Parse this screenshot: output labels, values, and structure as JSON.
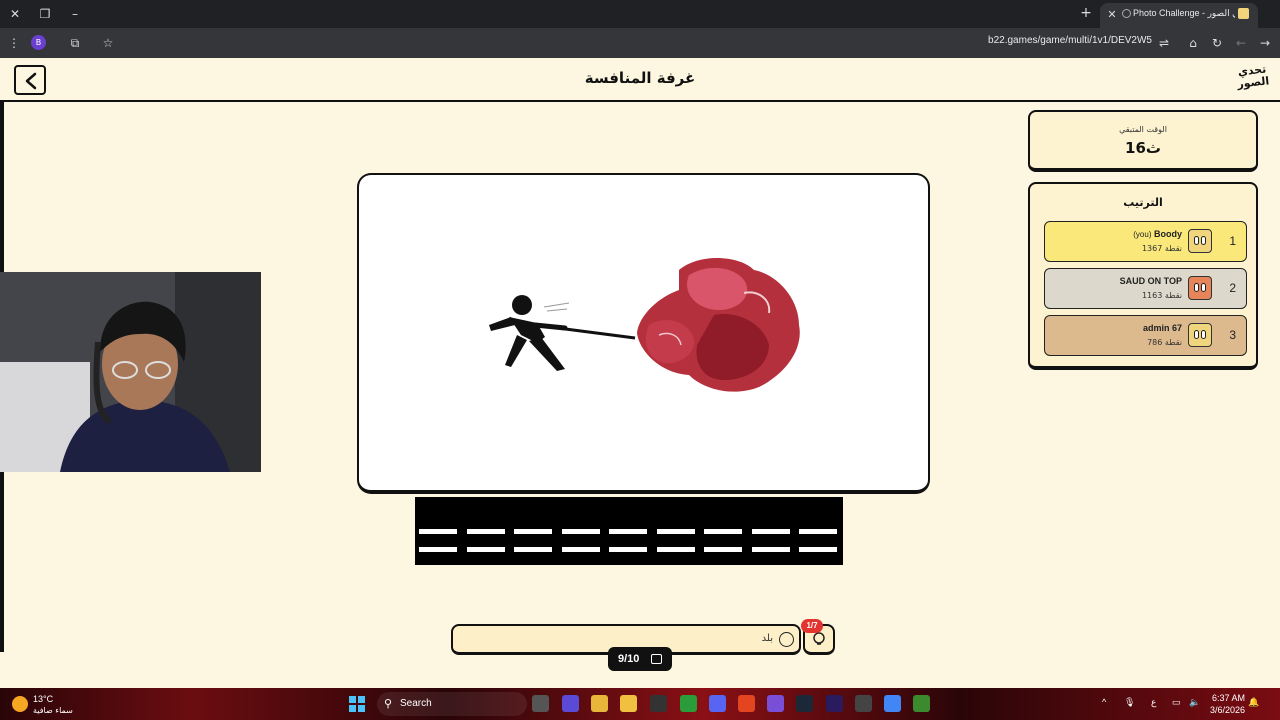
{
  "browser": {
    "tab_title": "Photo Challenge - تحدي الصور",
    "url": "b22.games/game/multi/1v1/DEV2W5",
    "profile_initial": "B"
  },
  "header": {
    "title": "غرفة المنافسة",
    "logo_text": "تحدي الصور"
  },
  "timer": {
    "label": "الوقت المتبقي",
    "value": "16ث"
  },
  "ranking": {
    "title": "الترتيب",
    "players": [
      {
        "rank": "1",
        "name": "Boody",
        "you_tag": "(you)",
        "score": "1367 نقطة"
      },
      {
        "rank": "2",
        "name": "SAUD ON TOP",
        "you_tag": "",
        "score": "1163 نقطة"
      },
      {
        "rank": "3",
        "name": "admin 67",
        "you_tag": "",
        "score": "786 نقطة"
      }
    ]
  },
  "guess": {
    "text": "بلد"
  },
  "hint": {
    "badge": "1/7"
  },
  "progress": {
    "counter": "9/10"
  },
  "colors": {
    "background": "#fdf6e0",
    "rank1": "#fae97a",
    "rank2": "#dcd8cb",
    "rank3": "#ddb98e",
    "badge": "#e3342f"
  },
  "taskbar": {
    "temperature": "13°C",
    "weather": "سماء صافية",
    "search_label": "Search",
    "time": "6:37 AM",
    "date": "3/6/2026",
    "lang": "ع"
  }
}
